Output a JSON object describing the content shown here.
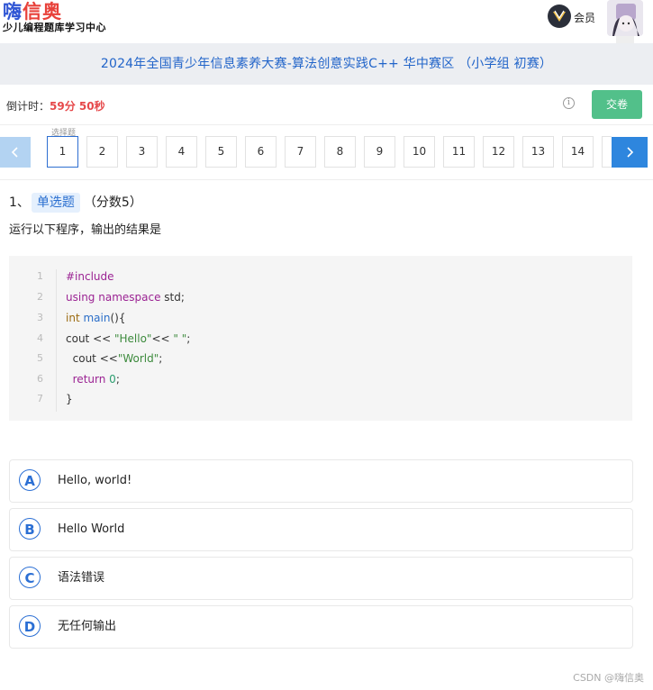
{
  "header": {
    "logo_part1": "嗨",
    "logo_part2": "信奥",
    "logo_subtitle": "少儿编程题库学习中心",
    "vip_label": "会员"
  },
  "exam": {
    "title": "2024年全国青少年信息素养大赛-算法创意实践C++ 华中赛区 （小学组 初赛）"
  },
  "timer": {
    "label": "倒计时：",
    "value": "59分 50秒",
    "submit_label": "交卷"
  },
  "navigator": {
    "type_hint": "选择题",
    "current": 1,
    "questions": [
      "1",
      "2",
      "3",
      "4",
      "5",
      "6",
      "7",
      "8",
      "9",
      "10",
      "11",
      "12",
      "13",
      "14"
    ]
  },
  "question": {
    "number": "1、",
    "type": "单选题",
    "score": "（分数5）",
    "text": "运行以下程序，输出的结果是",
    "code_lines": [
      "#include",
      "using namespace std;",
      "int main(){",
      "cout << \"Hello\"<< \" \";",
      "  cout <<\"World\";",
      "  return 0;",
      "}"
    ],
    "line_numbers": [
      "1",
      "2",
      "3",
      "4",
      "5",
      "6",
      "7"
    ]
  },
  "options": [
    {
      "letter": "A",
      "text": "Hello, world!"
    },
    {
      "letter": "B",
      "text": "Hello World"
    },
    {
      "letter": "C",
      "text": "语法错误"
    },
    {
      "letter": "D",
      "text": "无任何输出"
    }
  ],
  "footer": {
    "watermark": "CSDN @嗨信奥"
  },
  "colors": {
    "accent": "#2e86de",
    "submit": "#52c08a",
    "timer": "#e6484a",
    "title": "#2164c9"
  },
  "icons": [
    "vip-crown-icon",
    "info-icon",
    "chevron-left-icon",
    "chevron-right-icon"
  ]
}
